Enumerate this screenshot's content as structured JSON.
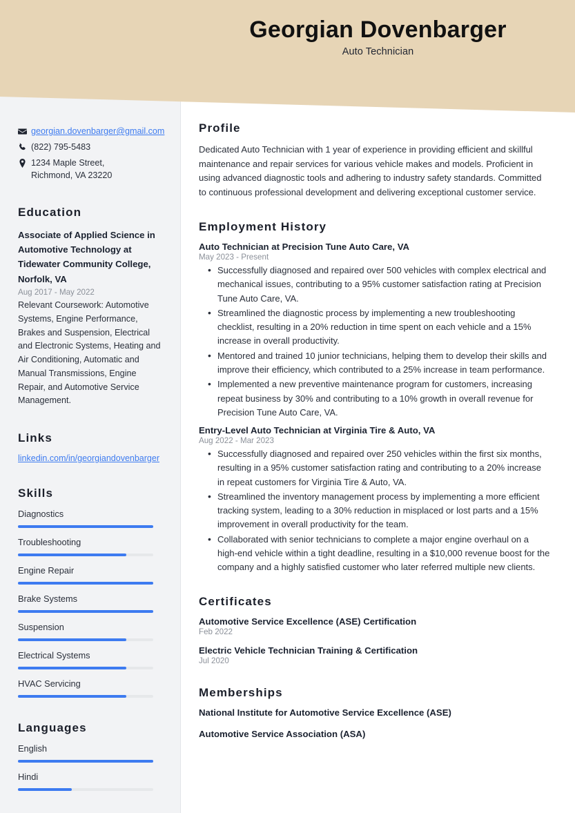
{
  "header": {
    "name": "Georgian Dovenbarger",
    "job_title": "Auto Technician",
    "banner_color": "#e7d5b6"
  },
  "theme": {
    "accent": "#3d7bf0",
    "sidebar_bg": "#f2f3f5",
    "heading_color": "#1b1f2a",
    "muted_text": "#8b9099"
  },
  "sidebar": {
    "contact": {
      "email": "georgian.dovenbarger@gmail.com",
      "phone": "(822) 795-5483",
      "address_line1": "1234 Maple Street,",
      "address_line2": "Richmond, VA 23220",
      "email_icon": "envelope-icon",
      "phone_icon": "phone-icon",
      "location_icon": "map-pin-icon"
    },
    "education": {
      "heading": "Education",
      "degree": "Associate of Applied Science in Automotive Technology at Tidewater Community College, Norfolk, VA",
      "date": "Aug 2017 - May 2022",
      "description": "Relevant Coursework: Automotive Systems, Engine Performance, Brakes and Suspension, Electrical and Electronic Systems, Heating and Air Conditioning, Automatic and Manual Transmissions, Engine Repair, and Automotive Service Management."
    },
    "links": {
      "heading": "Links",
      "items": [
        {
          "label": "linkedin.com/in/georgiandovenbarger"
        }
      ]
    },
    "skills": {
      "heading": "Skills",
      "items": [
        {
          "label": "Diagnostics",
          "level": 100
        },
        {
          "label": "Troubleshooting",
          "level": 80
        },
        {
          "label": "Engine Repair",
          "level": 100
        },
        {
          "label": "Brake Systems",
          "level": 100
        },
        {
          "label": "Suspension",
          "level": 80
        },
        {
          "label": "Electrical Systems",
          "level": 80
        },
        {
          "label": "HVAC Servicing",
          "level": 80
        }
      ]
    },
    "languages": {
      "heading": "Languages",
      "items": [
        {
          "label": "English",
          "level": 100
        },
        {
          "label": "Hindi",
          "level": 40
        }
      ]
    }
  },
  "main": {
    "profile": {
      "heading": "Profile",
      "text": "Dedicated Auto Technician with 1 year of experience in providing efficient and skillful maintenance and repair services for various vehicle makes and models. Proficient in using advanced diagnostic tools and adhering to industry safety standards. Committed to continuous professional development and delivering exceptional customer service."
    },
    "employment": {
      "heading": "Employment History",
      "jobs": [
        {
          "title": "Auto Technician at Precision Tune Auto Care, VA",
          "date": "May 2023 - Present",
          "bullets": [
            "Successfully diagnosed and repaired over 500 vehicles with complex electrical and mechanical issues, contributing to a 95% customer satisfaction rating at Precision Tune Auto Care, VA.",
            "Streamlined the diagnostic process by implementing a new troubleshooting checklist, resulting in a 20% reduction in time spent on each vehicle and a 15% increase in overall productivity.",
            "Mentored and trained 10 junior technicians, helping them to develop their skills and improve their efficiency, which contributed to a 25% increase in team performance.",
            "Implemented a new preventive maintenance program for customers, increasing repeat business by 30% and contributing to a 10% growth in overall revenue for Precision Tune Auto Care, VA."
          ]
        },
        {
          "title": "Entry-Level Auto Technician at Virginia Tire & Auto, VA",
          "date": "Aug 2022 - Mar 2023",
          "bullets": [
            "Successfully diagnosed and repaired over 250 vehicles within the first six months, resulting in a 95% customer satisfaction rating and contributing to a 20% increase in repeat customers for Virginia Tire & Auto, VA.",
            "Streamlined the inventory management process by implementing a more efficient tracking system, leading to a 30% reduction in misplaced or lost parts and a 15% improvement in overall productivity for the team.",
            "Collaborated with senior technicians to complete a major engine overhaul on a high-end vehicle within a tight deadline, resulting in a $10,000 revenue boost for the company and a highly satisfied customer who later referred multiple new clients."
          ]
        }
      ]
    },
    "certificates": {
      "heading": "Certificates",
      "items": [
        {
          "name": "Automotive Service Excellence (ASE) Certification",
          "date": "Feb 2022"
        },
        {
          "name": "Electric Vehicle Technician Training & Certification",
          "date": "Jul 2020"
        }
      ]
    },
    "memberships": {
      "heading": "Memberships",
      "items": [
        {
          "name": "National Institute for Automotive Service Excellence (ASE)"
        },
        {
          "name": "Automotive Service Association (ASA)"
        }
      ]
    }
  }
}
